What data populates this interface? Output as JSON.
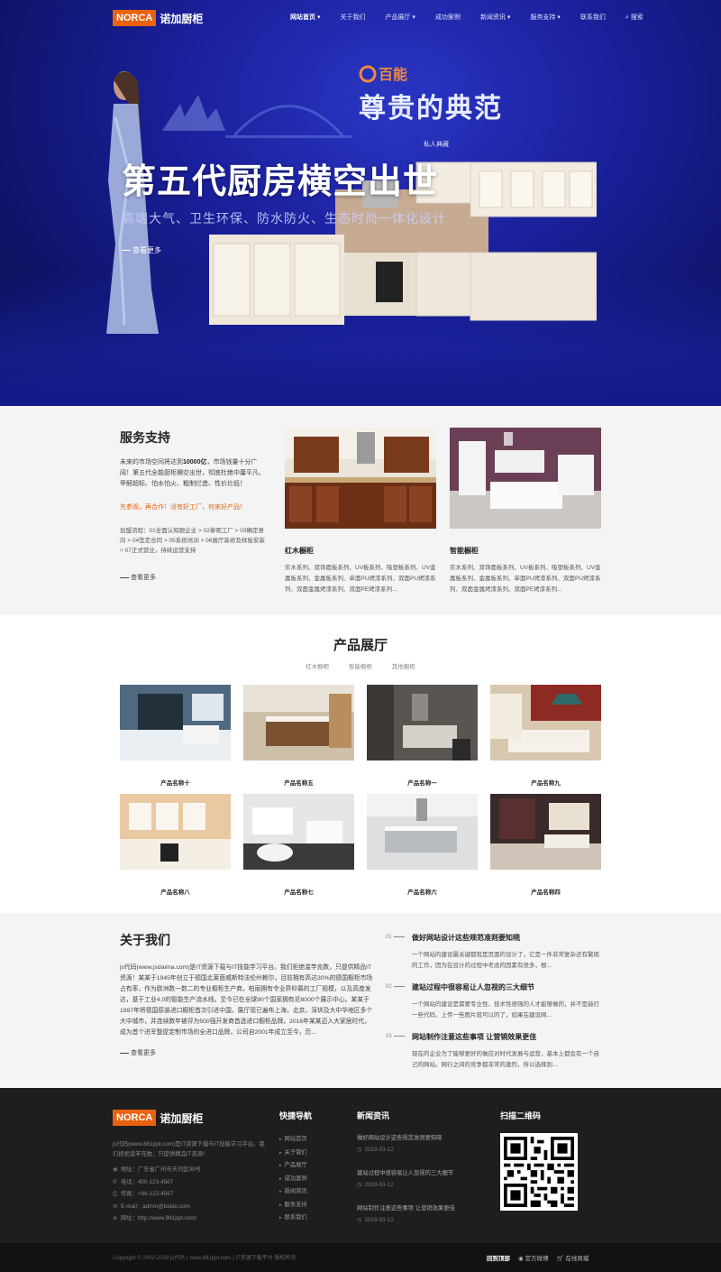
{
  "header": {
    "logo_badge": "NORCA",
    "logo_name": "诺加厨柜",
    "menu": [
      {
        "label": "网站首页 ▾",
        "active": true
      },
      {
        "label": "关于我们"
      },
      {
        "label": "产品展厅 ▾"
      },
      {
        "label": "成功案例"
      },
      {
        "label": "新闻资讯 ▾"
      },
      {
        "label": "服务支持 ▾"
      },
      {
        "label": "联系我们"
      }
    ],
    "search_label": "⌕ 搜索"
  },
  "hero": {
    "brand": "百能",
    "tagline": "尊贵的典范",
    "private": "私人典藏",
    "title": "第五代厨房横空出世",
    "subtitle": "高端大气、卫生环保、防水防火、生态时尚一体化设计",
    "more": "查看更多"
  },
  "service": {
    "title": "服务支持",
    "desc_pre": "未来的市场空间将达到",
    "desc_bold": "10000亿",
    "desc_post": "，市场钱量十分广阔！第五代全能厨柜横空出世，彻底杜绝中庸平凡、甲醛超标、怕水怕火、粗制烂造、性价比低！",
    "slogan": "先参观，再合作！没有好工厂，何来好产品！",
    "process": "加盟流程：01全面认知跟企业 > 02参观工厂 > 03确定意向 > 04签定合同 > 05系统培训 > 06展厅装修及样板安装 > 07正式营业，持续运营支持",
    "more": "查看更多",
    "cards": [
      {
        "title": "红木橱柜",
        "desc": "实木系列、双饰面板系列、UV板系列、吸塑板系列、UV金属板系列、金属板系列、单面PU烤漆系列、双面PU烤漆系列、双面金属烤漆系列、双面PE烤漆系列..."
      },
      {
        "title": "智能橱柜",
        "desc": "实木系列、双饰面板系列、UV板系列、吸塑板系列、UV金属板系列、金属板系列、单面PU烤漆系列、双面PU烤漆系列、双面金属烤漆系列、双面PE烤漆系列..."
      }
    ]
  },
  "products": {
    "title": "产品展厅",
    "tabs": [
      "红木橱柜",
      "智能橱柜",
      "其他橱柜"
    ],
    "items": [
      "产品名称十",
      "产品名称五",
      "产品名称一",
      "产品名称九",
      "产品名称八",
      "产品名称七",
      "产品名称六",
      "产品名称四"
    ]
  },
  "about": {
    "title": "关于我们",
    "text": "js代码(www.jsdaima.com)是IT资源下载与IT技能学习平台。我们拒绝滥竽充数，只提供精品IT资源！某某于1945年创立于德国北莱茵威斯特法伦州赖尔，目前拥有高达30%的德国橱柜市场占有率，作为欧洲数一数二的专业橱柜生产商，柏丽拥有令业界仰慕的工厂规模，以及高度发达，基于工业4.0的智能生产流水线。至今已在全球90个国家拥有近8000个展示中心。某某于1997年将德国原装进口橱柜首次引进中国，展厅现已遍布上海，北京，深圳及大中华地区多个大中城市，并连续数年被评为500强开发商首选进口橱柜品牌。2016年某某迈入大家居时代，成为首个进军整屋定制市场的全进口品牌。公司自2001年成立至今，历...",
    "more": "查看更多",
    "news": [
      {
        "num": "01",
        "title": "做好网站设计这些规范准则要知晓",
        "desc": "一个网站的建设最关键都就是页面的设计了，它是一件非常复杂还有繁琐的工作，因为在设计的过程中考虑的因素有很多，根..."
      },
      {
        "num": "02",
        "title": "建站过程中很容易让人忽视的三大细节",
        "desc": "一个网站的建设是需要专业性、技术性很强的人才能够做的，并不是敲打一些代码、上传一些图片就可以的了，如果在建设网..."
      },
      {
        "num": "03",
        "title": "网站制作注意这些事项 让营销效果更佳",
        "desc": "现在的企业为了能够更好的做应对时代发展与运营，基本上都会有一个自己的网站。网行之间的竞争都非常的激烈，所以选择到..."
      }
    ]
  },
  "footer": {
    "logo_badge": "NORCA",
    "logo_name": "诺加厨柜",
    "intro": "js代码(www.861ppt.com)是IT资源下载与IT技能学习平台。我们拒绝滥竽充数，只提供精品IT资源！",
    "address": "地址：广东省广州市天河区99号",
    "phone": "电话：400-123-4567",
    "fax": "传真：+86-123-4567",
    "email": "E-mail：admin@baidu.com",
    "website": "网址：http://www.861ppt.com/",
    "nav_title": "快捷导航",
    "nav": [
      "网站首页",
      "关于我们",
      "产品展厅",
      "成功案例",
      "新闻资讯",
      "服务支持",
      "联系我们"
    ],
    "news_title": "新闻资讯",
    "news": [
      {
        "title": "做好网站设计这些规范准则要知晓",
        "date": "2019-03-12"
      },
      {
        "title": "建站过程中很容易让人忽视的三大细节",
        "date": "2019-03-12"
      },
      {
        "title": "网站制作注意这些事项 让营销效果更佳",
        "date": "2019-03-12"
      }
    ],
    "qr_title": "扫描二维码",
    "copyright": "Copyright © 2002-2019 js代码 ( www.861ppt.com ) IT资源下载平台 版权所有",
    "bottom_links": [
      "回到顶部",
      "◉ 官方微博",
      "🛒 在线商城"
    ]
  }
}
